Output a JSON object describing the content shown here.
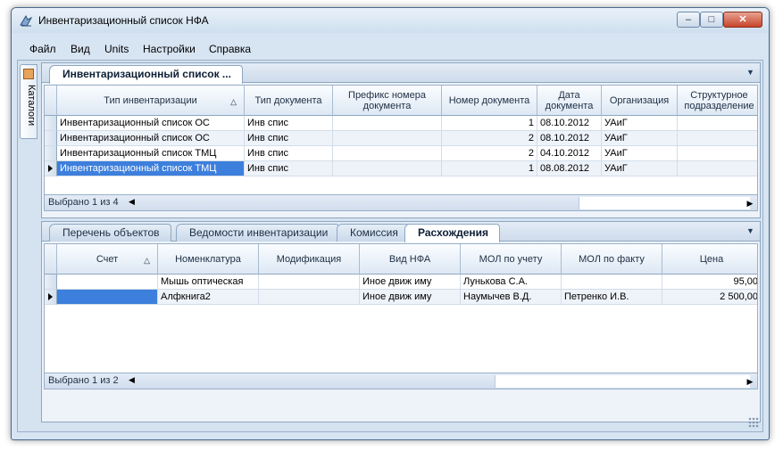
{
  "window": {
    "title": "Инвентаризационный список НФА",
    "icon": "app-icon"
  },
  "titlebar_buttons": {
    "minimize": "–",
    "maximize": "□",
    "close": "✕"
  },
  "menu": [
    "Файл",
    "Вид",
    "Units",
    "Настройки",
    "Справка"
  ],
  "sidebar": {
    "label": "Каталоги",
    "icon": "catalog-icon"
  },
  "top_panel": {
    "tab": "Инвентаризационный список ...",
    "columns": [
      "Тип инвентаризации",
      "Тип документа",
      "Префикс номера документа",
      "Номер документа",
      "Дата документа",
      "Организация",
      "Структурное подразделение"
    ],
    "rows": [
      [
        "Инвентаризационный список ОС",
        "Инв спис",
        "",
        "1",
        "08.10.2012",
        "УАиГ",
        ""
      ],
      [
        "Инвентаризационный список ОС",
        "Инв спис",
        "",
        "2",
        "08.10.2012",
        "УАиГ",
        ""
      ],
      [
        "Инвентаризационный список ТМЦ",
        "Инв спис",
        "",
        "2",
        "04.10.2012",
        "УАиГ",
        ""
      ],
      [
        "Инвентаризационный список ТМЦ",
        "Инв спис",
        "",
        "1",
        "08.08.2012",
        "УАиГ",
        ""
      ]
    ],
    "selected_row": 3,
    "footer": "Выбрано 1 из 4"
  },
  "bottom_panel": {
    "tabs": [
      "Перечень объектов",
      "Ведомости инвентаризации",
      "Комиссия",
      "Расхождения"
    ],
    "active_tab": 3,
    "columns": [
      "Счет",
      "Номенклатура",
      "Модификация",
      "Вид НФА",
      "МОЛ по учету",
      "МОЛ по факту",
      "Цена"
    ],
    "rows": [
      [
        "",
        "Мышь оптическая",
        "",
        "Иное движ иму",
        "Лунькова С.А.",
        "",
        "95,00"
      ],
      [
        "",
        "Алфкнига2",
        "",
        "Иное движ иму",
        "Наумычев В.Д.",
        "Петренко И.В.",
        "2 500,00"
      ]
    ],
    "selected_row": 1,
    "footer": "Выбрано 1 из 2"
  },
  "colors": {
    "selection": "#3d7fdc",
    "frame": "#d7e4f2"
  }
}
